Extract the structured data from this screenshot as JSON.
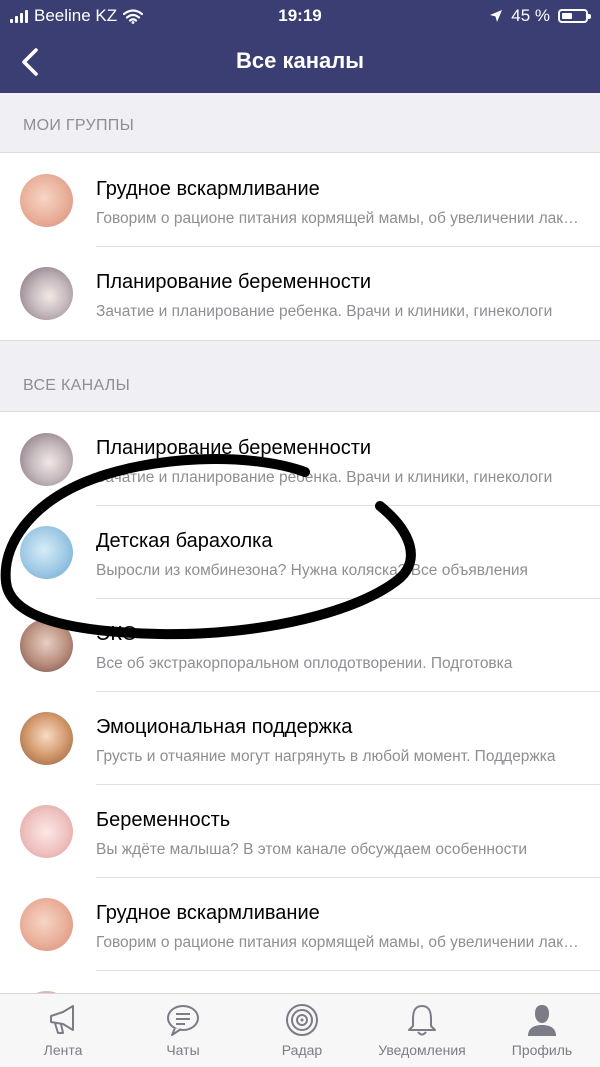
{
  "status_bar": {
    "carrier": "Beeline KZ",
    "time": "19:19",
    "battery_percent": "45 %",
    "battery_level": 0.45,
    "icons": [
      "signal-icon",
      "wifi-icon",
      "location-arrow-icon",
      "battery-icon"
    ]
  },
  "nav": {
    "title": "Все каналы",
    "back_icon": "chevron-left-icon"
  },
  "colors": {
    "nav_background": "#3b3e72",
    "section_background": "#efeff4",
    "secondary_text": "#8e8e93"
  },
  "sections": {
    "my_groups": "МОИ ГРУППЫ",
    "all_channels": "ВСЕ КАНАЛЫ"
  },
  "my_groups": [
    {
      "name": "Грудное вскармливание",
      "desc": "Говорим о рационе питания кормящей мамы, об увеличении лактации"
    },
    {
      "name": "Планирование беременности",
      "desc": "Зачатие и планирование ребенка. Врачи и клиники, гинекологи"
    }
  ],
  "all_channels": [
    {
      "name": "Планирование беременности",
      "desc": "Зачатие и планирование ребенка. Врачи и клиники, гинекологи"
    },
    {
      "name": "Детская барахолка",
      "desc": "Выросли из комбинезона? Нужна коляска? Все объявления"
    },
    {
      "name": "ЭКО",
      "desc": "Все об экстракорпоральном оплодотворении. Подготовка"
    },
    {
      "name": "Эмоциональная поддержка",
      "desc": "Грусть и отчаяние могут нагрянуть в любой момент. Поддержка"
    },
    {
      "name": "Беременность",
      "desc": "Вы ждёте малыша? В этом канале обсуждаем особенности"
    },
    {
      "name": "Грудное вскармливание",
      "desc": "Говорим о рационе питания кормящей мамы, об увеличении лактации"
    }
  ],
  "tabs": [
    {
      "label": "Лента",
      "icon": "megaphone-icon"
    },
    {
      "label": "Чаты",
      "icon": "chat-bubble-icon"
    },
    {
      "label": "Радар",
      "icon": "radar-icon"
    },
    {
      "label": "Уведомления",
      "icon": "bell-icon"
    },
    {
      "label": "Профиль",
      "icon": "person-icon",
      "active": true
    }
  ]
}
